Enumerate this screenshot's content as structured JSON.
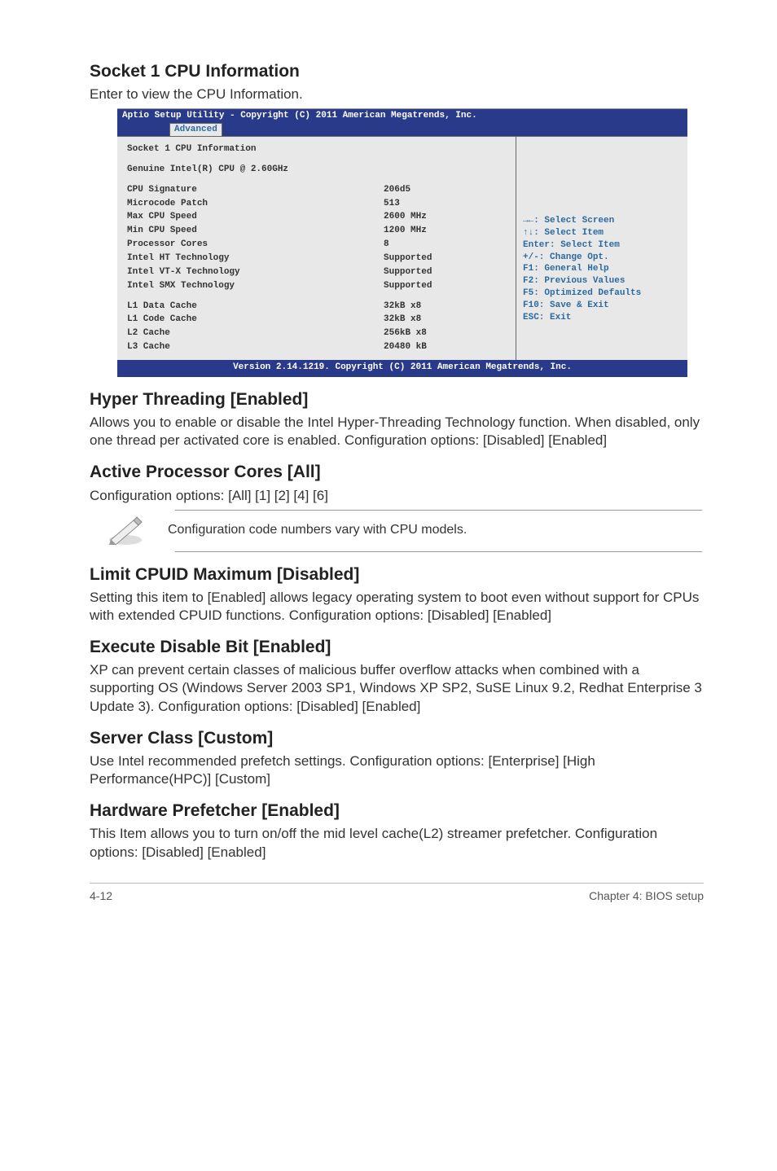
{
  "headings": {
    "socket1": "Socket 1 CPU Information",
    "socket1_sub": "Enter to view the CPU Information.",
    "hyper": "Hyper Threading [Enabled]",
    "hyper_p": "Allows you to enable or disable the Intel Hyper-Threading Technology function. When disabled, only one thread per activated core is enabled. Configuration options: [Disabled] [Enabled]",
    "active": "Active Processor Cores [All]",
    "active_p": "Configuration options: [All] [1] [2] [4] [6]",
    "note": "Configuration code numbers vary with CPU models.",
    "limit": "Limit CPUID Maximum [Disabled]",
    "limit_p": "Setting this item to [Enabled] allows legacy operating system to boot even without support for CPUs with extended CPUID functions. Configuration options: [Disabled] [Enabled]",
    "exec": "Execute Disable Bit [Enabled]",
    "exec_p": "XP can prevent certain classes of malicious buffer overflow attacks when combined with a supporting OS (Windows Server 2003 SP1, Windows XP SP2, SuSE Linux 9.2, Redhat Enterprise 3 Update 3). Configuration options: [Disabled] [Enabled]",
    "server": "Server Class [Custom]",
    "server_p": "Use Intel recommended prefetch settings. Configuration options: [Enterprise] [High Performance(HPC)] [Custom]",
    "hw": "Hardware Prefetcher [Enabled]",
    "hw_p": "This Item allows you to turn on/off the mid level cache(L2) streamer prefetcher. Configuration options: [Disabled] [Enabled]"
  },
  "bios": {
    "header_title": "Aptio Setup Utility - Copyright (C) 2011 American Megatrends, Inc.",
    "tab": "Advanced",
    "section1": "Socket 1 CPU Information",
    "section2": "Genuine Intel(R) CPU @ 2.60GHz",
    "rows": [
      {
        "k": "CPU Signature",
        "v": "206d5"
      },
      {
        "k": "Microcode Patch",
        "v": "513"
      },
      {
        "k": "Max CPU Speed",
        "v": "2600 MHz"
      },
      {
        "k": "Min CPU Speed",
        "v": "1200 MHz"
      },
      {
        "k": "Processor Cores",
        "v": "8"
      },
      {
        "k": "Intel HT Technology",
        "v": "Supported"
      },
      {
        "k": "Intel VT-X Technology",
        "v": "Supported"
      },
      {
        "k": "Intel SMX Technology",
        "v": "Supported"
      }
    ],
    "rows2": [
      {
        "k": "L1 Data Cache",
        "v": "32kB x8"
      },
      {
        "k": "L1 Code Cache",
        "v": "32kB x8"
      },
      {
        "k": "L2 Cache",
        "v": "256kB x8"
      },
      {
        "k": "L3 Cache",
        "v": "20480 kB"
      }
    ],
    "legend": [
      "→←: Select Screen",
      "↑↓:  Select Item",
      "Enter: Select Item",
      "+/-: Change Opt.",
      "F1: General Help",
      "F2: Previous Values",
      "F5: Optimized Defaults",
      "F10: Save & Exit",
      "ESC: Exit"
    ],
    "footer": "Version 2.14.1219. Copyright (C) 2011 American Megatrends, Inc."
  },
  "footer": {
    "left": "4-12",
    "right": "Chapter 4: BIOS setup"
  }
}
